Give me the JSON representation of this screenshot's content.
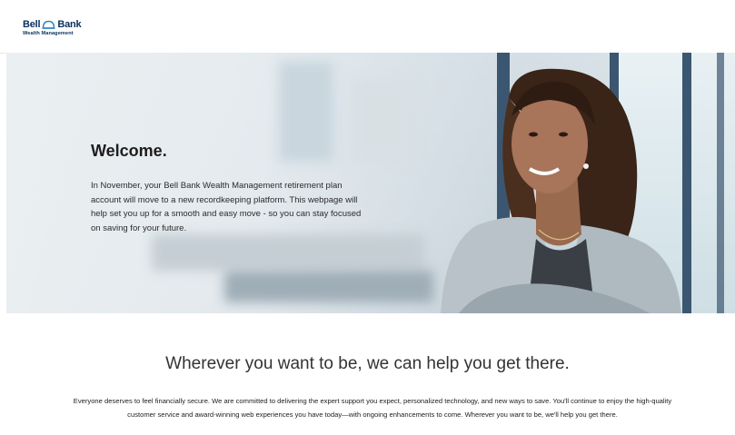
{
  "header": {
    "logo": {
      "name_left": "Bell",
      "name_right": "Bank",
      "subtitle": "Wealth Management",
      "icon": "bell-icon",
      "color": "#0a2f5c"
    }
  },
  "hero": {
    "title": "Welcome.",
    "body": "In November, your Bell Bank Wealth Management retirement plan account will move to a new recordkeeping platform. This webpage will help set you up for a smooth and easy move - so you can stay focused on saving for your future.",
    "image": "woman-portrait-image"
  },
  "section": {
    "heading": "Wherever you want to be, we can help you get there.",
    "body": "Everyone deserves to feel financially secure. We are committed to delivering the expert support you expect, personalized technology, and new ways to save. You'll continue to enjoy the high-quality customer service and award-winning web experiences you have today—with ongoing enhancements to come. Wherever you want to be, we'll help you get there."
  }
}
